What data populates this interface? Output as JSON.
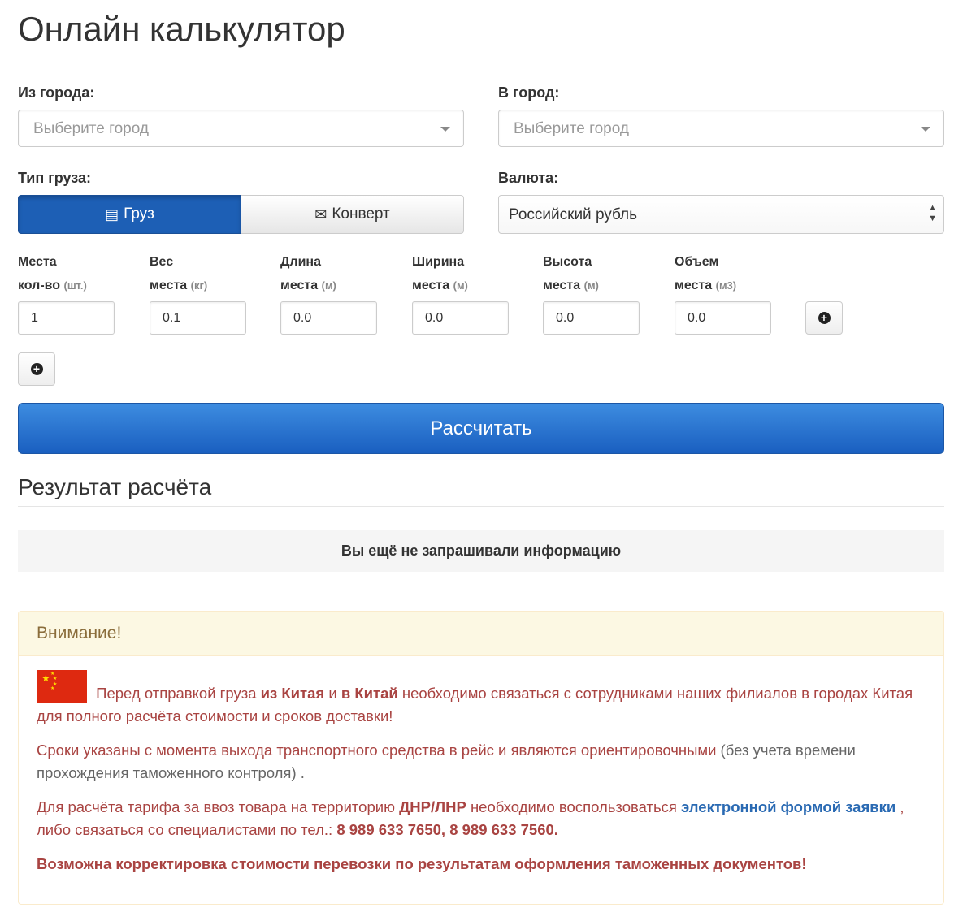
{
  "page": {
    "title": "Онлайн калькулятор"
  },
  "from_city": {
    "label": "Из города:",
    "placeholder": "Выберите город"
  },
  "to_city": {
    "label": "В город:",
    "placeholder": "Выберите город"
  },
  "cargo_type": {
    "label": "Тип груза:",
    "options": [
      "Груз",
      "Конверт"
    ],
    "selected": "Груз"
  },
  "currency": {
    "label": "Валюта:",
    "value": "Российский рубль"
  },
  "places": {
    "columns": [
      {
        "line1": "Места",
        "line2": "кол-во",
        "unit": "(шт.)",
        "value": "1"
      },
      {
        "line1": "Вес",
        "line2": "места",
        "unit": "(кг)",
        "value": "0.1"
      },
      {
        "line1": "Длина",
        "line2": "места",
        "unit": "(м)",
        "value": "0.0"
      },
      {
        "line1": "Ширина",
        "line2": "места",
        "unit": "(м)",
        "value": "0.0"
      },
      {
        "line1": "Высота",
        "line2": "места",
        "unit": "(м)",
        "value": "0.0"
      },
      {
        "line1": "Объем",
        "line2": "места",
        "unit": "(м3)",
        "value": "0.0"
      }
    ]
  },
  "calculate_button": "Рассчитать",
  "result": {
    "title": "Результат расчёта",
    "empty_message": "Вы ещё не запрашивали информацию"
  },
  "warning": {
    "heading": "Внимание!",
    "p1": {
      "t1": "Перед отправкой груза ",
      "b1": "из Китая",
      "t2": " и ",
      "b2": "в Китай",
      "t3": " необходимо связаться с сотрудниками наших филиалов в городах Китая для полного расчёта стоимости и сроков доставки!"
    },
    "p2": {
      "t1": "Сроки указаны с момента выхода транспортного средства в рейс и являются ориентировочными",
      "t2": " (без учета времени прохождения таможенного контроля) ."
    },
    "p3": {
      "t1": "Для расчёта тарифа за ввоз товара на территорию ",
      "b1": "ДНР/ЛНР",
      "t2": " необходимо воспользоваться ",
      "link": "электронной формой заявки",
      "t3": " , либо связаться со специалистами по тел.: ",
      "phones": "8 989 633 7650,  8 989 633 7560."
    },
    "p4": "Возможна корректировка стоимости перевозки по результатам оформления таможенных документов!"
  },
  "colors": {
    "primary": "#1d5fb5",
    "danger_text": "#a94442",
    "warning_bg": "#fcf8e3",
    "link": "#2a6ab3",
    "flag_red": "#de2910"
  }
}
